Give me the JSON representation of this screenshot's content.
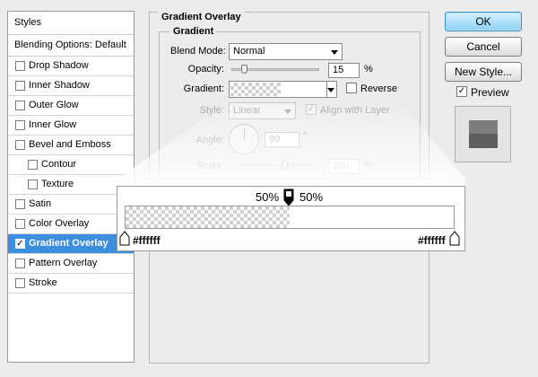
{
  "sidebar": {
    "header": "Styles",
    "blending": "Blending Options: Default",
    "items": [
      {
        "label": "Drop Shadow",
        "checked": false,
        "sub": false,
        "active": false
      },
      {
        "label": "Inner Shadow",
        "checked": false,
        "sub": false,
        "active": false
      },
      {
        "label": "Outer Glow",
        "checked": false,
        "sub": false,
        "active": false
      },
      {
        "label": "Inner Glow",
        "checked": false,
        "sub": false,
        "active": false
      },
      {
        "label": "Bevel and Emboss",
        "checked": false,
        "sub": false,
        "active": false
      },
      {
        "label": "Contour",
        "checked": false,
        "sub": true,
        "active": false
      },
      {
        "label": "Texture",
        "checked": false,
        "sub": true,
        "active": false
      },
      {
        "label": "Satin",
        "checked": false,
        "sub": false,
        "active": false
      },
      {
        "label": "Color Overlay",
        "checked": false,
        "sub": false,
        "active": false
      },
      {
        "label": "Gradient Overlay",
        "checked": true,
        "sub": false,
        "active": true
      },
      {
        "label": "Pattern Overlay",
        "checked": false,
        "sub": false,
        "active": false
      },
      {
        "label": "Stroke",
        "checked": false,
        "sub": false,
        "active": false
      }
    ]
  },
  "panel": {
    "title": "Gradient Overlay",
    "group_title": "Gradient",
    "blend_mode_label": "Blend Mode:",
    "blend_mode_value": "Normal",
    "opacity_label": "Opacity:",
    "opacity_value": "15",
    "opacity_unit": "%",
    "opacity_level": 0.15,
    "gradient_label": "Gradient:",
    "reverse_label": "Reverse",
    "style_label": "Style:",
    "style_value": "Linear",
    "align_label": "Align with Layer",
    "align_checked": true,
    "angle_label": "Angle:",
    "angle_value": "90",
    "angle_unit": "°",
    "scale_label": "Scale:",
    "scale_value": "100",
    "scale_unit": "%"
  },
  "gradient_editor": {
    "midpoint_left": "50%",
    "midpoint_right": "50%",
    "stop_left": "#ffffff",
    "stop_right": "#ffffff"
  },
  "buttons": {
    "ok": "OK",
    "cancel": "Cancel",
    "new_style": "New Style...",
    "preview_label": "Preview",
    "preview_checked": true
  },
  "colors": {
    "accent": "#3c8edf",
    "preview_top": "#7d7d7d",
    "preview_bottom": "#5e5e5e"
  }
}
